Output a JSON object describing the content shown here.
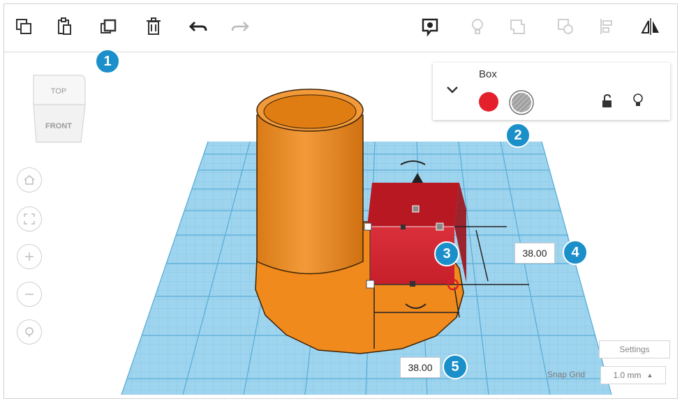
{
  "selected_shape": {
    "name": "Box",
    "solid_color": "#e3202c",
    "hole_color": "#a9a9a9"
  },
  "view_cube": {
    "top_label": "TOP",
    "front_label": "FRONT"
  },
  "dimensions": {
    "height": "38.00",
    "width": "38.00"
  },
  "markers": [
    "1",
    "2",
    "3",
    "4",
    "5"
  ],
  "bottom_bar": {
    "settings_label": "Settings",
    "snap_grid_label": "Snap Grid",
    "snap_grid_value": "1.0 mm"
  },
  "colors": {
    "marker": "#1a8fc9",
    "workplane": "#9fd4ee",
    "cylinder": "#f08a1c"
  },
  "icons": [
    "copy-icon",
    "paste-icon",
    "duplicate-icon",
    "delete-icon",
    "undo-icon",
    "redo-icon",
    "show-all-icon",
    "light-bulb-icon",
    "group-icon",
    "ungroup-icon",
    "align-icon",
    "mirror-icon"
  ]
}
